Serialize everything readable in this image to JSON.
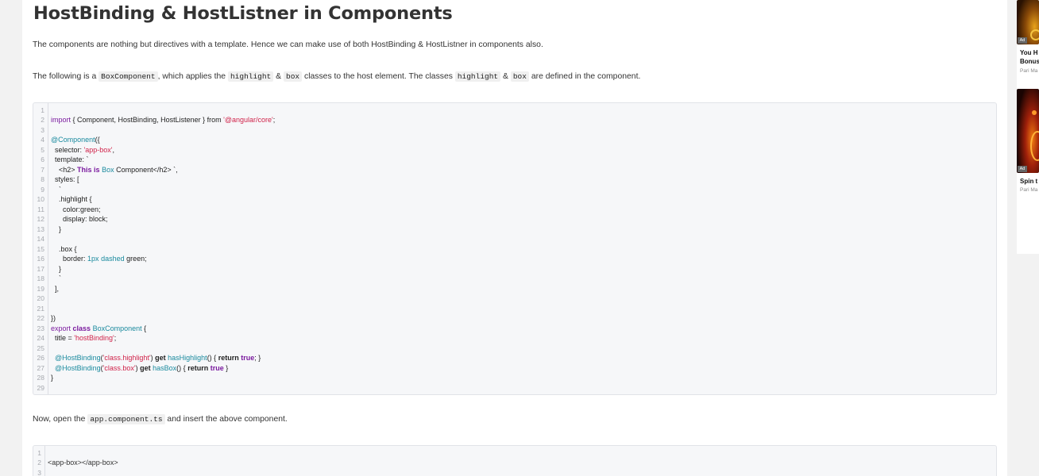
{
  "article": {
    "title": "HostBinding & HostListner in Components",
    "intro": "The components are nothing but directives with a template. Hence we can make use of both HostBinding & HostListner in components also.",
    "following": {
      "t1": "The following is a ",
      "c1": "BoxComponent",
      "t2": ", which applies the ",
      "c2": "highlight",
      "t3": " & ",
      "c3": "box",
      "t4": " classes to the host element. The classes ",
      "c4": "highlight",
      "t5": " & ",
      "c5": "box",
      "t6": " are defined in the component."
    },
    "now_open": {
      "t1": "Now, open the ",
      "c1": "app.component.ts",
      "t2": " and insert the above component."
    }
  },
  "code1": {
    "line_numbers": [
      "1",
      "2",
      "3",
      "4",
      "5",
      "6",
      "7",
      "8",
      "9",
      "10",
      "11",
      "12",
      "13",
      "14",
      "15",
      "16",
      "17",
      "18",
      "19",
      "20",
      "21",
      "22",
      "23",
      "24",
      "25",
      "26",
      "27",
      "28",
      "29"
    ],
    "l2": {
      "a": "import",
      "b": " { Component, HostBinding, HostListener } ",
      "c": "from",
      "d": " ",
      "e": "'@angular/core'",
      "f": ";"
    },
    "l4": {
      "a": "@Component",
      "b": "({"
    },
    "l5": {
      "a": "  selector: ",
      "b": "'app-box'",
      "c": ","
    },
    "l6": {
      "a": "  template: `"
    },
    "l7": {
      "a": "    <h2> ",
      "b": "This is",
      "c": " ",
      "d": "Box",
      "e": " Component</h2> `,"
    },
    "l8": {
      "a": "  styles: ["
    },
    "l9": {
      "a": "    `"
    },
    "l10": {
      "a": "    .highlight {"
    },
    "l11": {
      "a": "      color:green;"
    },
    "l12": {
      "a": "      display: block;"
    },
    "l13": {
      "a": "    }"
    },
    "l15": {
      "a": "    .box {"
    },
    "l16": {
      "a": "      border: ",
      "b": "1px",
      "c": " ",
      "d": "dashed",
      "e": " green;"
    },
    "l17": {
      "a": "    }"
    },
    "l18": {
      "a": "    `"
    },
    "l19": {
      "a": "  ],"
    },
    "l22": {
      "a": "})"
    },
    "l23": {
      "a": "export",
      "b": " ",
      "c": "class",
      "d": " ",
      "e": "BoxComponent",
      "f": " {"
    },
    "l24": {
      "a": "  title = ",
      "b": "'hostBinding'",
      "c": ";"
    },
    "l26": {
      "a": "  @HostBinding",
      "b": "(",
      "c": "'class.highlight'",
      "d": ") ",
      "e": "get",
      "f": " ",
      "g": "hasHighlight",
      "h": "() { ",
      "i": "return",
      "j": " ",
      "k": "true",
      "l": "; }"
    },
    "l27": {
      "a": "  @HostBinding",
      "b": "(",
      "c": "'class.box'",
      "d": ") ",
      "e": "get",
      "f": " ",
      "g": "hasBox",
      "h": "() { ",
      "i": "return",
      "j": " ",
      "k": "true",
      "l": " }"
    },
    "l28": {
      "a": "}"
    }
  },
  "code2": {
    "line_numbers": [
      "1",
      "2",
      "3"
    ],
    "l2": {
      "a": "<app-box></app-box>"
    }
  },
  "sidebar": {
    "ad1": {
      "badge": "Ad",
      "line1": "You H",
      "line2": "Bonus",
      "source": "Pari Ma"
    },
    "ad2": {
      "badge": "Ad",
      "line1": "Spin t",
      "source": "Pari Ma"
    }
  },
  "colors": {
    "keyword": "#7a1a9e",
    "string": "#d0234a",
    "decorator": "#1a8a9e",
    "code_background": "#f6f7f9"
  }
}
